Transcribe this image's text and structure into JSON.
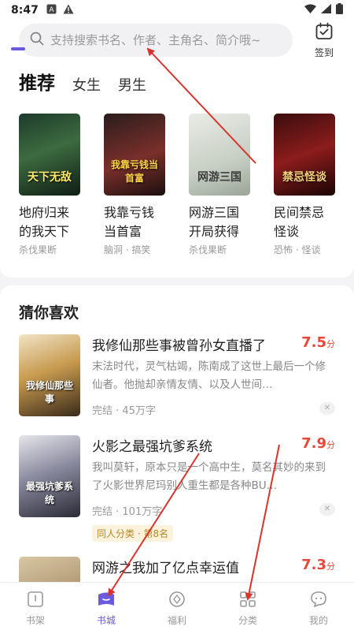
{
  "status_bar": {
    "time": "8:47",
    "left_icons": [
      "a-box-icon",
      "warning-icon"
    ],
    "right_icons": [
      "wifi-icon",
      "signal-icon",
      "battery-icon"
    ]
  },
  "search": {
    "placeholder": "支持搜索书名、作者、主角名、简介哦~",
    "icon": "search-icon"
  },
  "checkin": {
    "label": "签到",
    "icon": "calendar-check-icon"
  },
  "tabs": [
    {
      "label": "推荐",
      "active": true
    },
    {
      "label": "女生",
      "active": false
    },
    {
      "label": "男生",
      "active": false
    }
  ],
  "recommend": [
    {
      "title": "地府归来的我天下无敌",
      "display_title": "地府归来的我天下",
      "tags": "杀伐果断",
      "cover_text": "天下无敌"
    },
    {
      "title": "我靠亏钱当首富",
      "display_title": "我靠亏钱当首富",
      "tags": "脑洞 · 搞笑",
      "cover_text": "我靠亏钱当首富"
    },
    {
      "title": "网游三国开局获得",
      "display_title": "网游三国开局获得",
      "tags": "杀伐果断",
      "cover_text": "网游三国"
    },
    {
      "title": "民间禁忌怪谈",
      "display_title": "民间禁忌怪谈",
      "tags": "恐怖 · 怪谈",
      "cover_text": "禁忌怪谈"
    }
  ],
  "guess": {
    "title": "猜你喜欢",
    "books": [
      {
        "name": "我修仙那些事被曾孙女直播了",
        "score": "7.5",
        "score_unit": "分",
        "desc": "末法时代，灵气枯竭，陈南成了这世上最后一个修仙者。他抛却亲情友情、以及人世间…",
        "meta": "完结 · 45万字",
        "cover_text": "我修仙那些事"
      },
      {
        "name": "火影之最强坑爹系统",
        "score": "7.9",
        "score_unit": "分",
        "desc": "我叫莫轩，原本只是一个高中生，莫名其妙的来到了火影世界尼玛别人重生都是各种BU…",
        "meta": "完结 · 101万字",
        "badge": "同人分类 · 第8名",
        "cover_text": "最强坑爹系统"
      },
      {
        "name": "网游之我加了亿点幸运值",
        "score": "7.3",
        "score_unit": "分"
      }
    ]
  },
  "bottom_nav": [
    {
      "label": "书架",
      "icon": "bookshelf-icon",
      "active": false
    },
    {
      "label": "书城",
      "icon": "bookstore-icon",
      "active": true
    },
    {
      "label": "福利",
      "icon": "coin-icon",
      "active": false
    },
    {
      "label": "分类",
      "icon": "grid-icon",
      "active": false
    },
    {
      "label": "我的",
      "icon": "profile-icon",
      "active": false
    }
  ],
  "colors": {
    "accent": "#6a5ae0",
    "score": "#e8483a",
    "annotation_arrow": "#d9342b"
  }
}
